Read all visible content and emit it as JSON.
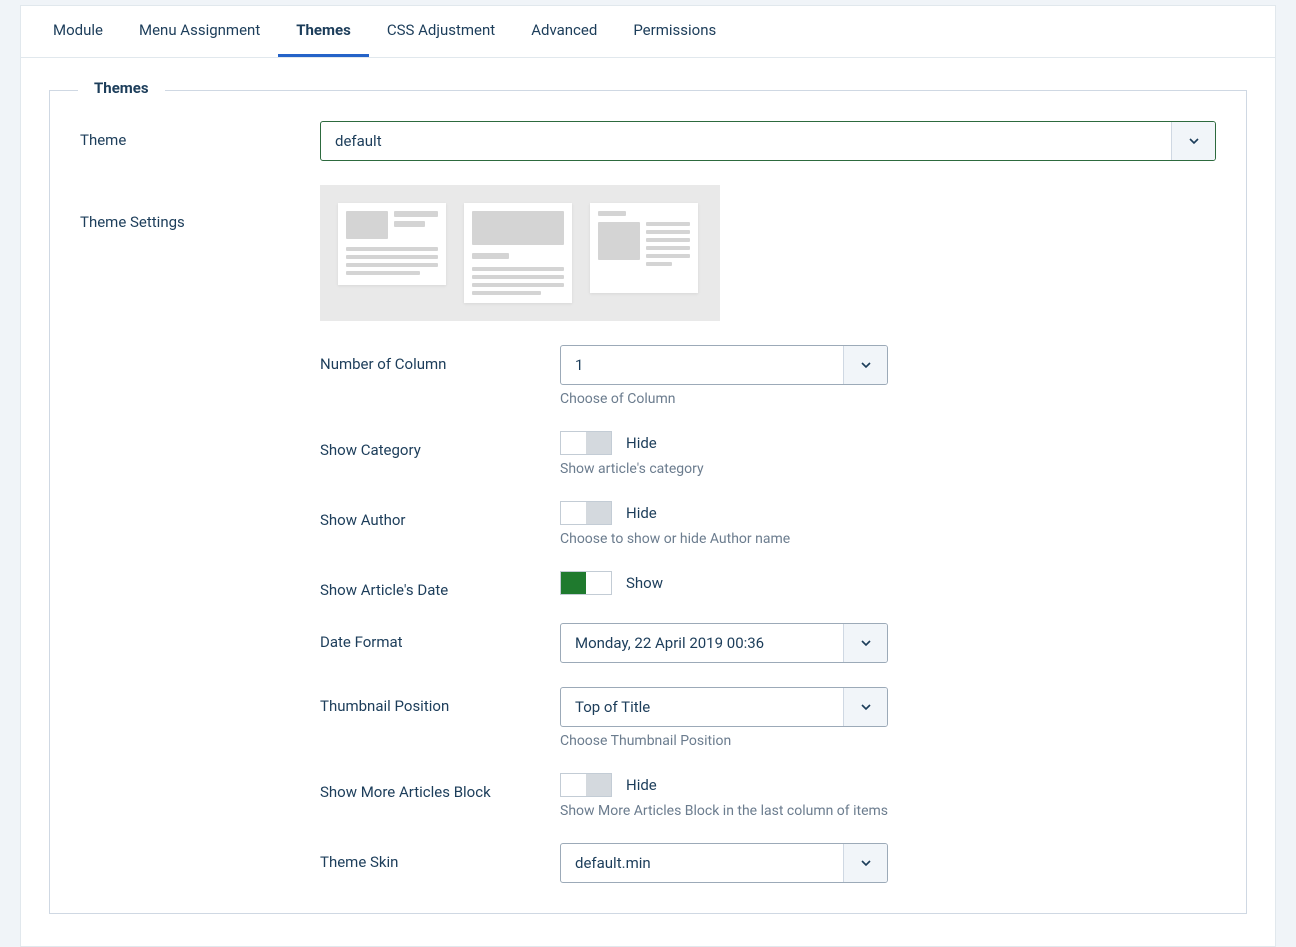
{
  "tabs": {
    "module": "Module",
    "menu_assignment": "Menu Assignment",
    "themes": "Themes",
    "css_adjustment": "CSS Adjustment",
    "advanced": "Advanced",
    "permissions": "Permissions"
  },
  "fieldset": {
    "legend": "Themes"
  },
  "theme": {
    "label": "Theme",
    "value": "default"
  },
  "theme_settings": {
    "label": "Theme Settings"
  },
  "num_column": {
    "label": "Number of Column",
    "value": "1",
    "helper": "Choose of Column"
  },
  "show_category": {
    "label": "Show Category",
    "state": "Hide",
    "helper": "Show article's category"
  },
  "show_author": {
    "label": "Show Author",
    "state": "Hide",
    "helper": "Choose to show or hide Author name"
  },
  "show_date": {
    "label": "Show Article's Date",
    "state": "Show"
  },
  "date_format": {
    "label": "Date Format",
    "value": "Monday, 22 April 2019 00:36"
  },
  "thumb_pos": {
    "label": "Thumbnail Position",
    "value": "Top of Title",
    "helper": "Choose Thumbnail Position"
  },
  "show_more": {
    "label": "Show More Articles Block",
    "state": "Hide",
    "helper": "Show More Articles Block in the last column of items"
  },
  "theme_skin": {
    "label": "Theme Skin",
    "value": "default.min"
  }
}
